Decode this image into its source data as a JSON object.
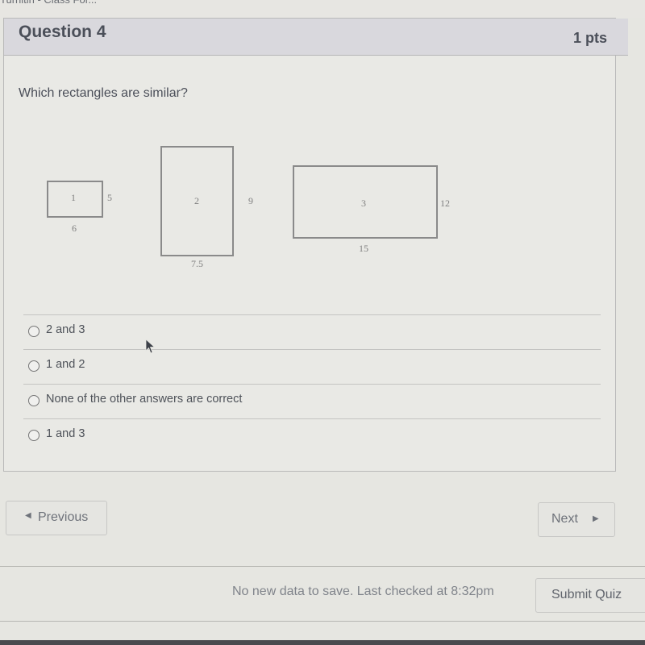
{
  "browser_tab_fragment": "Turnitin - Class For...",
  "question": {
    "title": "Question 4",
    "points": "1 pts",
    "prompt": "Which rectangles are similar?"
  },
  "figure": {
    "rectangles": [
      {
        "id": "1",
        "label": "1",
        "side_label": "5",
        "bottom_label": "6"
      },
      {
        "id": "2",
        "label": "2",
        "side_label": "9",
        "bottom_label": "7.5"
      },
      {
        "id": "3",
        "label": "3",
        "side_label": "12",
        "bottom_label": "15"
      }
    ]
  },
  "answers": [
    {
      "label": "2 and 3",
      "selected": false
    },
    {
      "label": "1 and 2",
      "selected": false
    },
    {
      "label": "None of the other answers are correct",
      "selected": false
    },
    {
      "label": "1 and 3",
      "selected": false
    }
  ],
  "navigation": {
    "previous_label": "Previous",
    "previous_icon": "left-triangle-icon",
    "next_label": "Next",
    "next_icon": "right-triangle-icon"
  },
  "footer": {
    "save_status": "No new data to save. Last checked at 8:32pm",
    "submit_label": "Submit Quiz"
  }
}
